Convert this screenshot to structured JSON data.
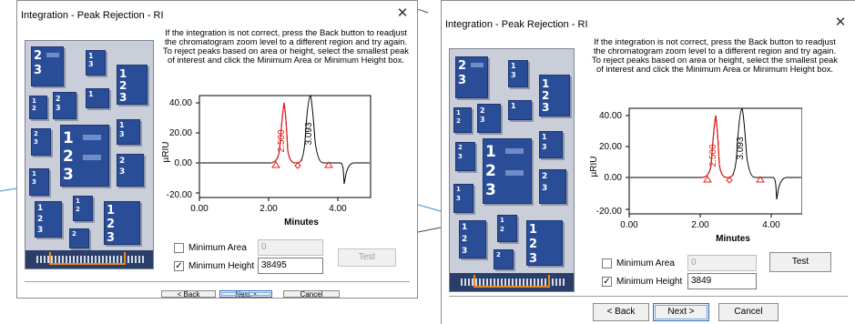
{
  "dialogs": [
    {
      "title": "Integration - Peak Rejection - RI",
      "instructions": [
        "If the integration is not correct, press the Back button to readjust",
        "the chromatogram zoom level to a different region and try again.",
        "To reject peaks based on area or height, select the smallest peak",
        "of interest and click the Minimum Area or Minimum Height box."
      ],
      "chart": {
        "y_axis_label": "µRIU",
        "x_axis_label": "Minutes",
        "y_ticks": [
          "40.00",
          "20.00",
          "0.00",
          "-20.00"
        ],
        "x_ticks": [
          "0.00",
          "2.00",
          "4.00"
        ],
        "peak_labels": [
          "2.500",
          "3.093"
        ]
      },
      "minimum_area": {
        "label": "Minimum Area",
        "checked": false,
        "value": "0"
      },
      "minimum_height": {
        "label": "Minimum Height",
        "checked": true,
        "value": "38495"
      },
      "test_label": "Test",
      "back_label": "< Back",
      "next_label": "Next >",
      "cancel_label": "Cancel"
    },
    {
      "title": "Integration - Peak Rejection - RI",
      "instructions": [
        "If the integration is not correct, press the Back button to readjust",
        "the chromatogram zoom level to a different region and try again.",
        "To reject peaks based on area or height, select the smallest peak",
        "of interest and click the Minimum Area or Minimum Height box."
      ],
      "chart": {
        "y_axis_label": "µRIU",
        "x_axis_label": "Minutes",
        "y_ticks": [
          "40.00",
          "20.00",
          "0.00",
          "-20.00"
        ],
        "x_ticks": [
          "0.00",
          "2.00",
          "4.00"
        ],
        "peak_labels": [
          "2.500",
          "3.093"
        ]
      },
      "minimum_area": {
        "label": "Minimum Area",
        "checked": false,
        "value": "0"
      },
      "minimum_height": {
        "label": "Minimum Height",
        "checked": true,
        "value": "3849"
      },
      "test_label": "Test",
      "back_label": "< Back",
      "next_label": "Next >",
      "cancel_label": "Cancel"
    }
  ],
  "icons": {
    "close": "close-icon",
    "checkbox_checked": "check-icon",
    "wizard_art": "document-stack-illustration"
  },
  "colors": {
    "chromatogram_red": "#e0201b",
    "tile_blue": "#2a4d98",
    "chip_orange": "#e68a1f"
  }
}
